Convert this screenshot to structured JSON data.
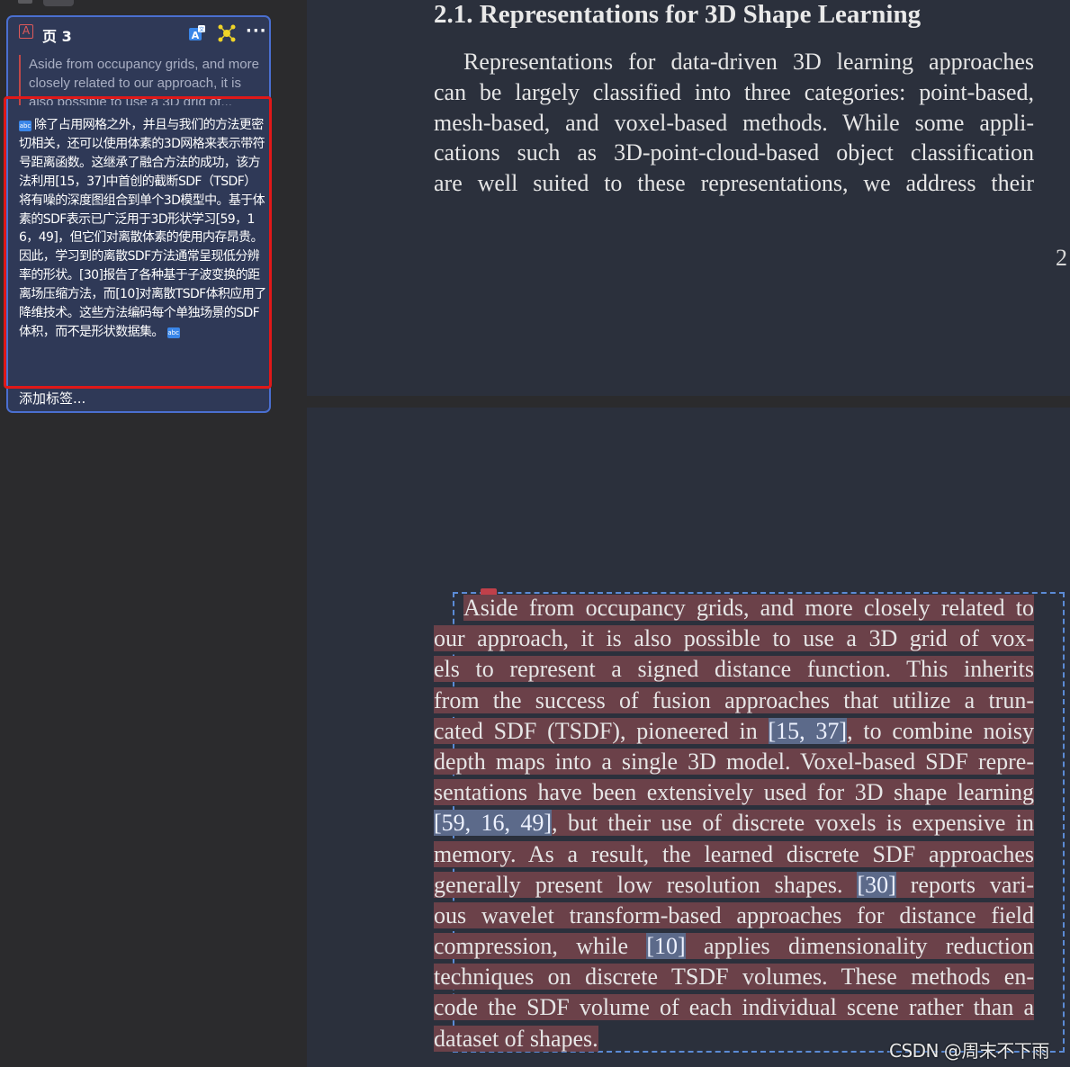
{
  "sidebar": {
    "card": {
      "page_label": "页 3",
      "quote_text": "Aside from occupancy grids, and more closely related to our approach, it is also possible to use a 3D grid of...",
      "translation_text": "除了占用网格之外，并且与我们的方法更密切相关，还可以使用体素的3D网格来表示带符号距离函数。这继承了融合方法的成功，该方法利用[15，37]中首创的截断SDF（TSDF）将有噪的深度图组合到单个3D模型中。基于体素的SDF表示已广泛用于3D形状学习[59，16，49]，但它们对离散体素的使用内存昂贵。因此，学习到的离散SDF方法通常呈现低分辨率的形状。[30]报告了各种基于子波变换的距离场压缩方法，而[10]对离散TSDF体积应用了降维技术。这些方法编码每个单独场景的SDF体积，而不是形状数据集。",
      "add_tag_label": "添加标签...",
      "icons": [
        "pdf-icon",
        "translate-icon",
        "sparkle-icon",
        "more-icon",
        "translate-badge-icon"
      ]
    }
  },
  "document": {
    "upper_page": {
      "heading": "2.1. Representations for 3D Shape Learning",
      "lines": [
        "Representations for data-driven 3D learning approaches",
        "can be largely classified into three categories: point-based,",
        "mesh-based, and voxel-based methods.  While some appli-",
        "cations such as 3D-point-cloud-based object classification",
        "are well suited to these representations, we address their"
      ],
      "page_number": "2"
    },
    "lower_page": {
      "lines": [
        {
          "parts": [
            "Aside from occupancy grids, and more closely related to"
          ]
        },
        {
          "parts": [
            "our approach, it is also possible to use a 3D grid of vox-"
          ]
        },
        {
          "parts": [
            "els to represent a signed distance function.  This inherits"
          ]
        },
        {
          "parts": [
            "from the success of fusion approaches that utilize a trun-"
          ]
        },
        {
          "parts": [
            "cated SDF (TSDF), pioneered in ",
            "[15, 37]",
            ", to combine noisy"
          ]
        },
        {
          "parts": [
            "depth maps into a single 3D model.  Voxel-based SDF repre-"
          ]
        },
        {
          "parts": [
            "sentations have been extensively used for 3D shape learning"
          ]
        },
        {
          "parts": [
            "[59, 16, 49]",
            ", but their use of discrete voxels is expensive in"
          ]
        },
        {
          "parts": [
            "memory.  As a result, the learned discrete SDF approaches"
          ]
        },
        {
          "parts": [
            "generally present low resolution shapes.  ",
            "[30]",
            " reports vari-"
          ]
        },
        {
          "parts": [
            "ous wavelet transform-based approaches for distance field"
          ]
        },
        {
          "parts": [
            "compression, while ",
            "[10]",
            " applies dimensionality reduction"
          ]
        },
        {
          "parts": [
            "techniques on discrete TSDF volumes.  These methods en-"
          ]
        },
        {
          "parts": [
            "code the SDF volume of each individual scene rather than a"
          ]
        },
        {
          "parts": [
            "dataset of shapes."
          ]
        }
      ]
    }
  },
  "watermark": "CSDN @周末不下雨",
  "colors": {
    "card_bg": "#2f3957",
    "card_border": "#4a6fd0",
    "red_outline": "#e01818",
    "highlight": "#6b4149",
    "citation": "#5c6a8a",
    "page_bg": "#2b303c"
  }
}
